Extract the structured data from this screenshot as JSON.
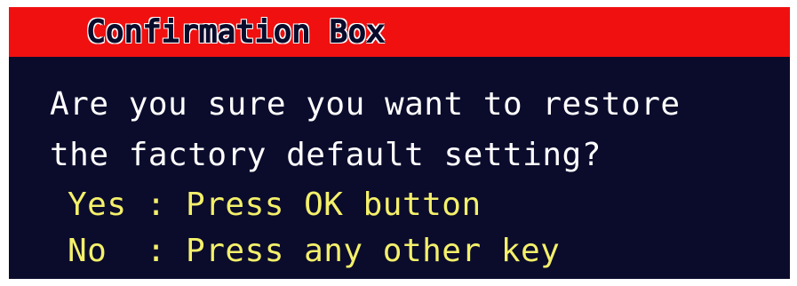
{
  "dialog": {
    "title": "Confirmation Box",
    "message_lines": [
      "Are you sure you want to restore",
      "the factory default setting?"
    ],
    "options": [
      {
        "label": "Yes : Press OK button"
      },
      {
        "label": "No  : Press any other key"
      }
    ]
  },
  "colors": {
    "title_bar": "#f01010",
    "background": "#0b0c2c",
    "message_text": "#ffffff",
    "option_text": "#f4f06a"
  }
}
